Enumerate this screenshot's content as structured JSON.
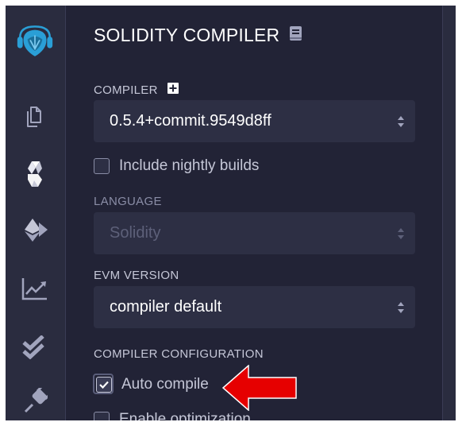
{
  "sidebar": {
    "icons": [
      {
        "name": "remix-logo"
      },
      {
        "name": "file-explorer"
      },
      {
        "name": "solidity-compiler"
      },
      {
        "name": "deploy-run"
      },
      {
        "name": "analytics"
      },
      {
        "name": "tests"
      },
      {
        "name": "plugin-manager"
      }
    ]
  },
  "panel": {
    "title": "SOLIDITY COMPILER",
    "compiler": {
      "label": "COMPILER",
      "value": "0.5.4+commit.9549d8ff"
    },
    "nightly": {
      "label": "Include nightly builds",
      "checked": false
    },
    "language": {
      "label": "LANGUAGE",
      "value": "Solidity",
      "disabled": true
    },
    "evm": {
      "label": "EVM VERSION",
      "value": "compiler default"
    },
    "config": {
      "label": "COMPILER CONFIGURATION",
      "auto_compile": {
        "label": "Auto compile",
        "checked": true
      },
      "optimization": {
        "label": "Enable optimization",
        "checked": false
      }
    }
  },
  "colors": {
    "background": "#222336",
    "sidebar": "#2a2c3f",
    "select_bg": "#2d2f44",
    "logo": "#2a9fd6",
    "annotation_arrow": "#e60000"
  }
}
